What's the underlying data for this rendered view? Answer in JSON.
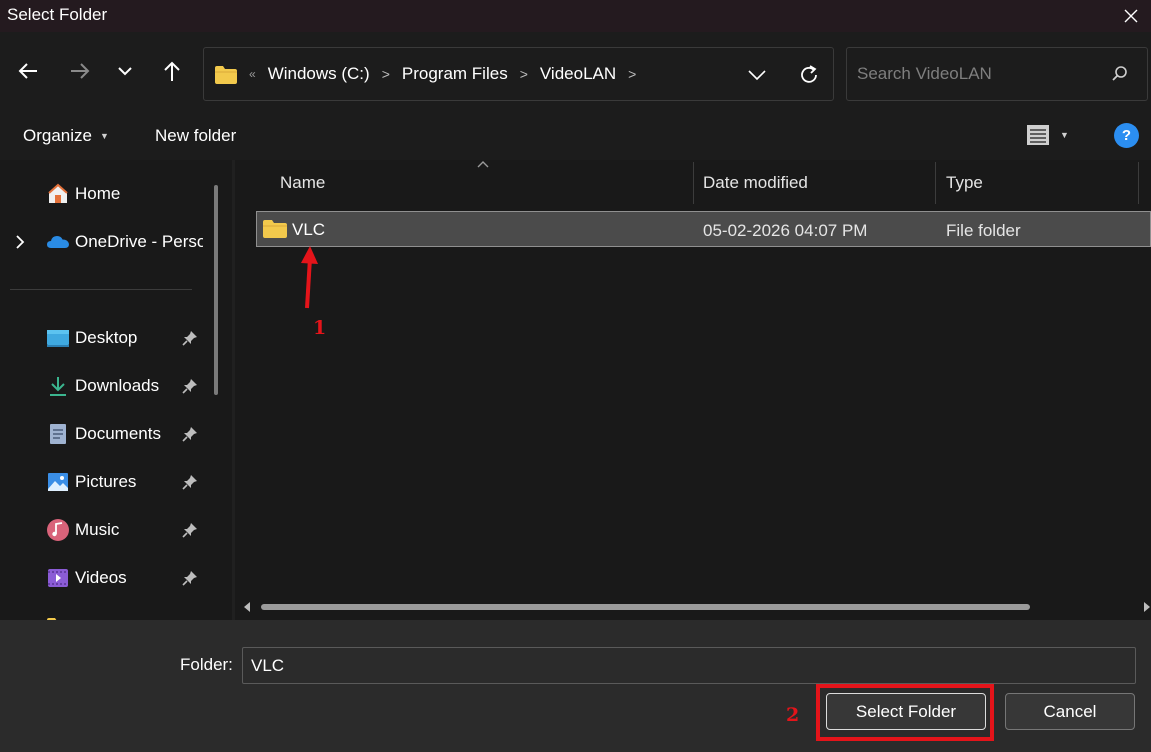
{
  "window": {
    "title": "Select Folder"
  },
  "address": {
    "overflow": "«",
    "crumbs": [
      "Windows (C:)",
      "Program Files",
      "VideoLAN"
    ]
  },
  "search": {
    "placeholder": "Search VideoLAN"
  },
  "toolbar": {
    "organize_label": "Organize",
    "new_folder_label": "New folder",
    "help_label": "?"
  },
  "sidebar": {
    "items": [
      {
        "label": "Home",
        "icon": "home-icon"
      },
      {
        "label": "OneDrive - Personal",
        "icon": "onedrive-icon"
      },
      {
        "label": "Desktop",
        "icon": "desktop-icon"
      },
      {
        "label": "Downloads",
        "icon": "downloads-icon"
      },
      {
        "label": "Documents",
        "icon": "documents-icon"
      },
      {
        "label": "Pictures",
        "icon": "pictures-icon"
      },
      {
        "label": "Music",
        "icon": "music-icon"
      },
      {
        "label": "Videos",
        "icon": "videos-icon"
      }
    ]
  },
  "columns": {
    "name": "Name",
    "date": "Date modified",
    "type": "Type"
  },
  "files": [
    {
      "name": "VLC",
      "date": "05-02-2026 04:07 PM",
      "type": "File folder"
    }
  ],
  "footer": {
    "folder_label": "Folder:",
    "folder_value": "VLC",
    "select_label": "Select Folder",
    "cancel_label": "Cancel"
  },
  "annotations": {
    "step1": "1",
    "step2": "2"
  },
  "colors": {
    "accent": "#2b8ef1",
    "annotation": "#e4141a",
    "folder": "#f2c94c"
  }
}
